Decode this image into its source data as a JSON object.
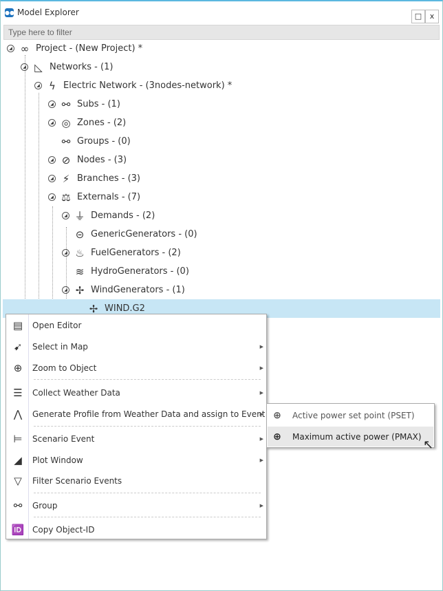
{
  "window": {
    "title": "Model Explorer",
    "maximize_icon": "□",
    "close_icon": "x"
  },
  "filter": {
    "placeholder": "Type here to filter"
  },
  "tree": [
    {
      "label": "Project - (New Project) *",
      "icon": "infinity-icon",
      "glyph": "∞"
    },
    {
      "label": "Networks - (1)",
      "icon": "network-icon",
      "glyph": "◺"
    },
    {
      "label": "Electric Network - (3nodes-network) *",
      "icon": "lightning-icon",
      "glyph": "ϟ"
    },
    {
      "label": "Subs - (1)",
      "icon": "subs-icon",
      "glyph": "⚯"
    },
    {
      "label": "Zones - (2)",
      "icon": "zones-icon",
      "glyph": "◎"
    },
    {
      "label": "Groups - (0)",
      "icon": "groups-icon",
      "glyph": "⚯"
    },
    {
      "label": "Nodes - (3)",
      "icon": "nodes-icon",
      "glyph": "⊘"
    },
    {
      "label": "Branches - (3)",
      "icon": "branches-icon",
      "glyph": "⚡"
    },
    {
      "label": "Externals - (7)",
      "icon": "externals-icon",
      "glyph": "⚖"
    },
    {
      "label": "Demands - (2)",
      "icon": "plug-icon",
      "glyph": "⏚"
    },
    {
      "label": "GenericGenerators - (0)",
      "icon": "generator-icon",
      "glyph": "⊝"
    },
    {
      "label": "FuelGenerators - (2)",
      "icon": "fuel-plant-icon",
      "glyph": "♨"
    },
    {
      "label": "HydroGenerators - (0)",
      "icon": "hydro-icon",
      "glyph": "≋"
    },
    {
      "label": "WindGenerators - (1)",
      "icon": "wind-turbine-icon",
      "glyph": "✢"
    },
    {
      "label": "WIND.G2",
      "icon": "wind-turbine-icon",
      "glyph": "✢"
    }
  ],
  "context_menu": [
    {
      "label": "Open Editor",
      "icon": "editor-icon",
      "glyph": "▤",
      "submenu": false
    },
    {
      "label": "Select in Map",
      "icon": "select-map-icon",
      "glyph": "➹",
      "submenu": true
    },
    {
      "label": "Zoom to Object",
      "icon": "zoom-in-icon",
      "glyph": "⊕",
      "submenu": true
    },
    {
      "label": "Collect Weather Data",
      "icon": "database-icon",
      "glyph": "☰",
      "submenu": true
    },
    {
      "label": "Generate Profile from Weather Data and assign to Event",
      "icon": "profile-curve-icon",
      "glyph": "⋀",
      "submenu": true
    },
    {
      "label": "Scenario Event",
      "icon": "scenario-event-icon",
      "glyph": "⊨",
      "submenu": true
    },
    {
      "label": "Plot Window",
      "icon": "area-chart-icon",
      "glyph": "◢",
      "submenu": true
    },
    {
      "label": "Filter Scenario Events",
      "icon": "filter-icon",
      "glyph": "▽",
      "submenu": false
    },
    {
      "label": "Group",
      "icon": "group-icon",
      "glyph": "⚯",
      "submenu": true
    },
    {
      "label": "Copy Object-ID",
      "icon": "id-icon",
      "glyph": "🆔",
      "submenu": false
    }
  ],
  "submenu": [
    {
      "label": "Active power set point (PSET)",
      "icon": "add-event-icon",
      "glyph": "⊕"
    },
    {
      "label": "Maximum active power (PMAX)",
      "icon": "add-event-icon",
      "glyph": "⊕",
      "highlighted": true
    }
  ],
  "arrow_glyph": "▶"
}
